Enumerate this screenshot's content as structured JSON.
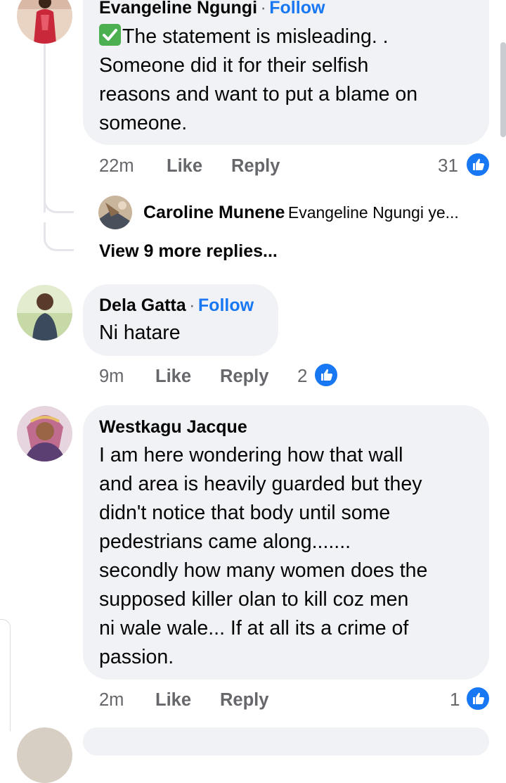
{
  "comments": [
    {
      "author": "Evangeline Ngungi",
      "follow": "Follow",
      "separator": "·",
      "check_emoji": "✅",
      "lines": [
        "The statement is misleading. .",
        "Someone did it for their selfish",
        "reasons and want to put a blame on",
        "someone."
      ],
      "time": "22m",
      "like": "Like",
      "reply": "Reply",
      "reactions": "31",
      "reply_preview": {
        "author": "Caroline Munene",
        "text": "Evangeline Ngungi ye..."
      },
      "more_replies": "View 9 more replies..."
    },
    {
      "author": "Dela Gatta",
      "follow": "Follow",
      "separator": "·",
      "lines": [
        "Ni hatare"
      ],
      "time": "9m",
      "like": "Like",
      "reply": "Reply",
      "reactions": "2"
    },
    {
      "author": "Westkagu Jacque",
      "lines": [
        "I am here wondering how that wall",
        "and area is heavily guarded but they",
        "didn't notice that body until some",
        "pedestrians came along.......",
        "secondly how many women does the",
        "supposed killer olan to kill coz men",
        "ni wale wale... If at all its a crime of",
        "passion."
      ],
      "time": "2m",
      "like": "Like",
      "reply": "Reply",
      "reactions": "1"
    }
  ],
  "colors": {
    "bubble": "#f0f2f5",
    "link": "#1877f2",
    "meta": "#65676b",
    "check": "#4caf50"
  },
  "icons": [
    "thumbs-up-icon",
    "check-mark-icon"
  ]
}
